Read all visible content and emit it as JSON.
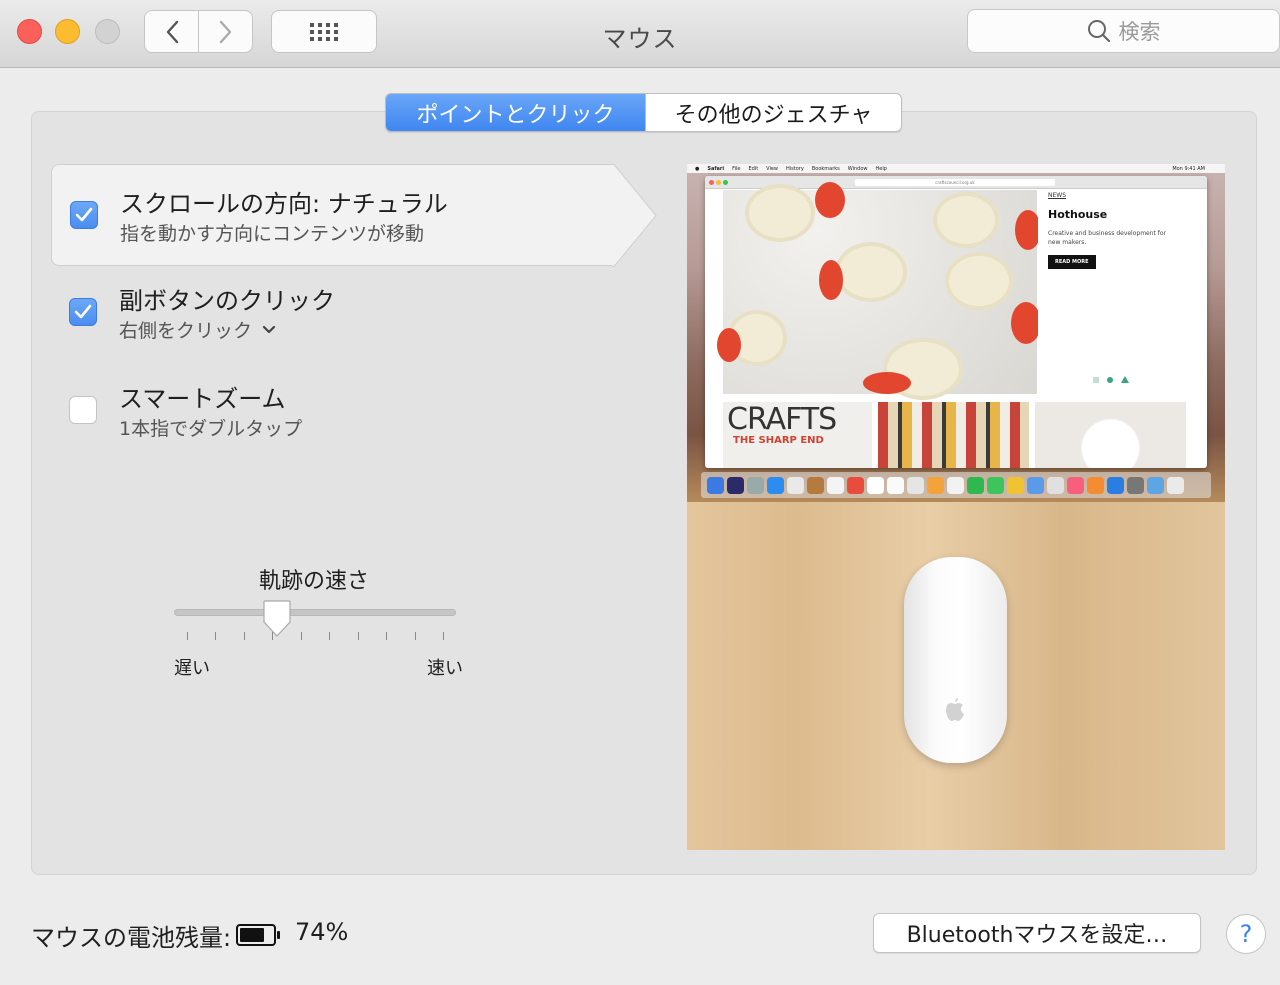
{
  "window": {
    "title": "マウス",
    "search_placeholder": "検索"
  },
  "tabs": [
    {
      "label": "ポイントとクリック",
      "active": true
    },
    {
      "label": "その他のジェスチャ",
      "active": false
    }
  ],
  "options": [
    {
      "title": "スクロールの方向: ナチュラル",
      "subtitle": "指を動かす方向にコンテンツが移動",
      "checked": true,
      "selected": true
    },
    {
      "title": "副ボタンのクリック",
      "subtitle": "右側をクリック",
      "checked": true,
      "selected": false,
      "has_dropdown": true
    },
    {
      "title": "スマートズーム",
      "subtitle": "1本指でダブルタップ",
      "checked": false,
      "selected": false
    }
  ],
  "tracking_speed": {
    "label": "軌跡の速さ",
    "min_label": "遅い",
    "max_label": "速い",
    "tick_count": 10,
    "value_fraction": 0.35
  },
  "preview": {
    "menubar": [
      "Safari",
      "File",
      "Edit",
      "View",
      "History",
      "Bookmarks",
      "Window",
      "Help"
    ],
    "clock": "Mon 9:41 AM",
    "url": "craftscouncil.org.uk",
    "side_tag": "NEWS",
    "side_title": "Hothouse",
    "side_desc": "Creative and business development for new makers.",
    "side_button": "READ MORE",
    "thumb_title": "CRAFTS",
    "thumb_subtitle": "THE SHARP END"
  },
  "battery": {
    "label": "マウスの電池残量:",
    "percent": "74%",
    "level": 0.74
  },
  "buttons": {
    "bluetooth": "Bluetoothマウスを設定…",
    "help": "?"
  },
  "colors": {
    "accent": "#4a8cf0",
    "close": "#fc605b",
    "minimize": "#fdbb2f",
    "zoom_disabled": "#d2d2d2"
  }
}
